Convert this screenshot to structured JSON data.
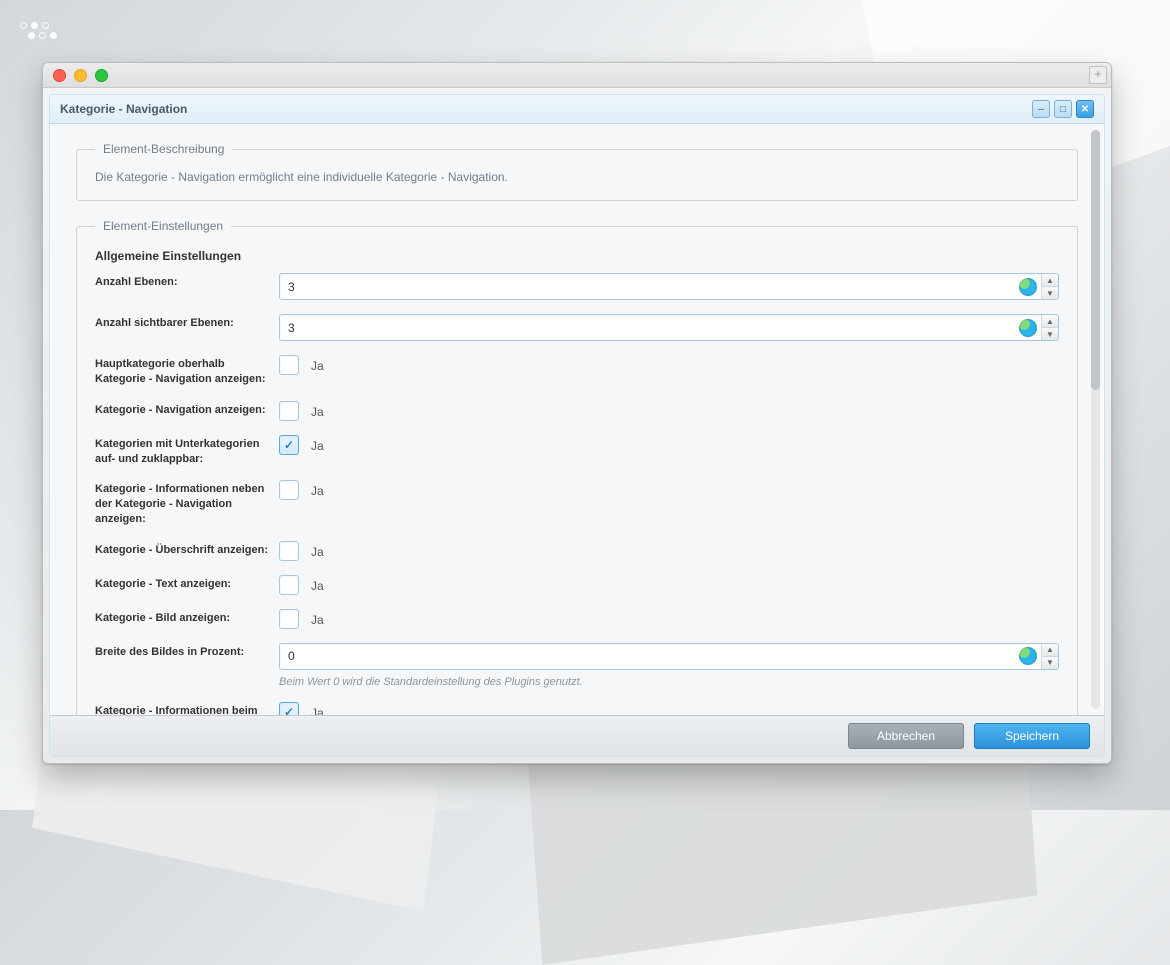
{
  "window": {
    "title": "Kategorie - Navigation",
    "tab_add_label": "+"
  },
  "description": {
    "legend": "Element-Beschreibung",
    "text": "Die Kategorie - Navigation ermöglicht eine individuelle Kategorie - Navigation."
  },
  "settings": {
    "legend": "Element-Einstellungen",
    "heading": "Allgemeine Einstellungen",
    "yes_label": "Ja",
    "fields": {
      "levels": {
        "label": "Anzahl Ebenen:",
        "value": "3"
      },
      "visible_levels": {
        "label": "Anzahl sichtbarer Ebenen:",
        "value": "3"
      },
      "main_cat_above": {
        "label": "Hauptkategorie oberhalb Kategorie - Navigation anzeigen:",
        "checked": false
      },
      "show_nav": {
        "label": "Kategorie - Navigation anzeigen:",
        "checked": false
      },
      "collapsible": {
        "label": "Kategorien mit Unterkategorien auf- und zuklappbar:",
        "checked": true
      },
      "info_beside": {
        "label": "Kategorie - Informationen neben der Kategorie - Navigation anzeigen:",
        "checked": false
      },
      "show_heading": {
        "label": "Kategorie - Überschrift anzeigen:",
        "checked": false
      },
      "show_text": {
        "label": "Kategorie - Text anzeigen:",
        "checked": false
      },
      "show_image": {
        "label": "Kategorie - Bild anzeigen:",
        "checked": false
      },
      "image_width": {
        "label": "Breite des Bildes in Prozent:",
        "value": "0",
        "help": "Beim Wert 0 wird die Standardeinstellung des Plugins genutzt."
      },
      "hover_update": {
        "label": "Kategorie - Informationen beim Hover über die Kategorie automatisch aktualisieren:",
        "checked": true
      }
    }
  },
  "footer": {
    "cancel": "Abbrechen",
    "save": "Speichern"
  },
  "win_controls": {
    "minimize": "–",
    "maximize": "□",
    "close": "✕"
  }
}
